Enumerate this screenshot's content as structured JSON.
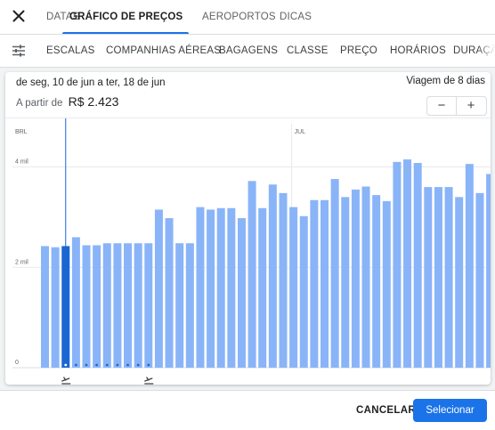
{
  "header": {
    "tabs": [
      {
        "label": "DATAS",
        "active": false
      },
      {
        "label": "GRÁFICO DE PREÇOS",
        "active": true
      },
      {
        "label": "AEROPORTOS",
        "active": false
      },
      {
        "label": "DICAS",
        "active": false
      }
    ]
  },
  "filters": [
    "ESCALAS",
    "COMPANHIAS AÉREAS",
    "BAGAGENS",
    "CLASSE",
    "PREÇO",
    "HORÁRIOS",
    "DURAÇÃO"
  ],
  "summary": {
    "dates": "de seg, 10 de jun a ter, 18 de jun",
    "from_label": "A partir de",
    "price": "R$ 2.423",
    "trip_length": "Viagem de 8 dias",
    "minus": "−",
    "plus": "+"
  },
  "footer": {
    "cancel": "CANCELAR",
    "select": "Selecionar"
  },
  "colors": {
    "accent": "#1a73e8",
    "bar": "#8ab4f8",
    "selected_bar": "#1967d2"
  },
  "chart_data": {
    "type": "bar",
    "currency_label": "BRL",
    "month_label": "JUL",
    "month_label_index": 24,
    "y_ticks": [
      {
        "value": 4000,
        "label": "4 mil"
      },
      {
        "value": 2000,
        "label": "2 mil"
      },
      {
        "value": 0,
        "label": "0"
      }
    ],
    "ylim": [
      0,
      4400
    ],
    "selected_index": 2,
    "trip_span": [
      2,
      10
    ],
    "values": [
      2423,
      2400,
      2423,
      2600,
      2440,
      2440,
      2480,
      2480,
      2480,
      2480,
      2480,
      3150,
      2980,
      2480,
      2480,
      3200,
      3150,
      3180,
      3180,
      2980,
      3720,
      3180,
      3650,
      3480,
      3200,
      3020,
      3340,
      3340,
      3760,
      3400,
      3550,
      3610,
      3440,
      3320,
      4100,
      4150,
      4080,
      3600,
      3600,
      3600,
      3400,
      4060,
      3480,
      3860
    ]
  }
}
